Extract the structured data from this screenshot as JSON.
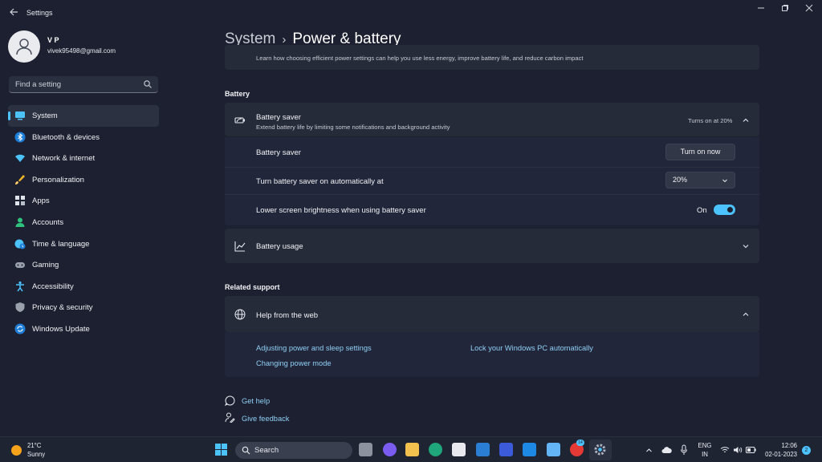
{
  "window": {
    "title": "Settings"
  },
  "profile": {
    "name": "V P",
    "email": "vivek95498@gmail.com"
  },
  "search": {
    "placeholder": "Find a setting"
  },
  "sidebar": {
    "items": [
      {
        "label": "System",
        "icon": "system-icon",
        "active": true
      },
      {
        "label": "Bluetooth & devices",
        "icon": "bluetooth-icon"
      },
      {
        "label": "Network & internet",
        "icon": "wifi-icon"
      },
      {
        "label": "Personalization",
        "icon": "brush-icon"
      },
      {
        "label": "Apps",
        "icon": "apps-icon"
      },
      {
        "label": "Accounts",
        "icon": "accounts-icon"
      },
      {
        "label": "Time & language",
        "icon": "globe-clock-icon"
      },
      {
        "label": "Gaming",
        "icon": "gamepad-icon"
      },
      {
        "label": "Accessibility",
        "icon": "accessibility-icon"
      },
      {
        "label": "Privacy & security",
        "icon": "shield-icon"
      },
      {
        "label": "Windows Update",
        "icon": "update-icon"
      }
    ]
  },
  "header": {
    "breadcrumb": "System",
    "title": "Power & battery"
  },
  "energy_tip": {
    "text": "Learn how choosing efficient power settings can help you use less energy, improve battery life, and reduce carbon impact"
  },
  "battery": {
    "section_title": "Battery",
    "saver": {
      "title": "Battery saver",
      "subtitle": "Extend battery life by limiting some notifications and background activity",
      "status": "Turns on at 20%",
      "row_label": "Battery saver",
      "button_label": "Turn on now",
      "auto_label": "Turn battery saver on automatically at",
      "auto_value": "20%",
      "brightness_label": "Lower screen brightness when using battery saver",
      "brightness_state": "On"
    },
    "usage_title": "Battery usage"
  },
  "related": {
    "section_title": "Related support",
    "help_title": "Help from the web",
    "links": [
      "Adjusting power and sleep settings",
      "Lock your Windows PC automatically",
      "Changing power mode"
    ]
  },
  "footer": {
    "get_help": "Get help",
    "give_feedback": "Give feedback"
  },
  "taskbar": {
    "weather_temp": "21°C",
    "weather_text": "Sunny",
    "search_label": "Search",
    "language": "ENG",
    "region": "IN",
    "time": "12:06",
    "date": "02-01-2023",
    "notification_count": "2",
    "chrome_badge": "14"
  },
  "colors": {
    "accent": "#4cc2ff",
    "background": "#1c2030",
    "card": "#262b3a"
  }
}
